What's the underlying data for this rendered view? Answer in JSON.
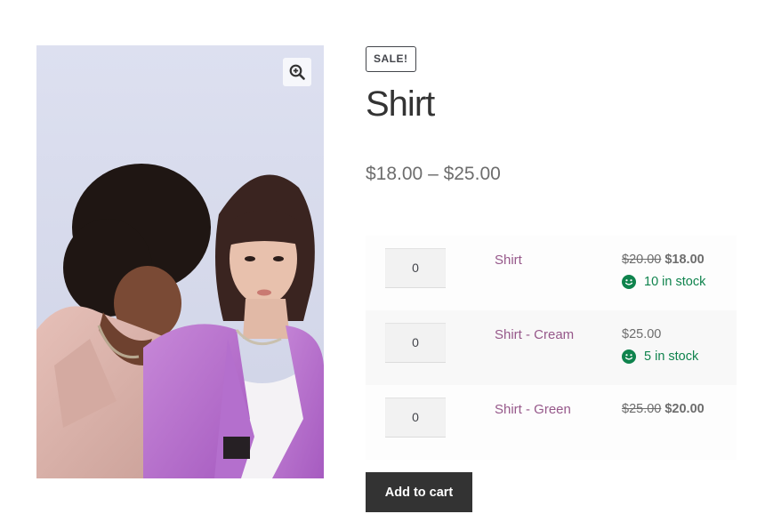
{
  "product": {
    "sale_badge": "SALE!",
    "title": "Shirt",
    "price_range": "$18.00 – $25.00"
  },
  "gallery": {
    "zoom_icon": "zoom-in-icon",
    "image_alt": "Two women in pink and purple shirts"
  },
  "grouped_items": [
    {
      "quantity": "0",
      "name": "Shirt",
      "old_price": "$20.00",
      "price": "$18.00",
      "stock": "10 in stock",
      "stock_icon": "smile-icon"
    },
    {
      "quantity": "0",
      "name": "Shirt - Cream",
      "old_price": "",
      "price": "$25.00",
      "stock": "5 in stock",
      "stock_icon": "smile-icon"
    },
    {
      "quantity": "0",
      "name": "Shirt - Green",
      "old_price": "$25.00",
      "price": "$20.00",
      "stock": "",
      "stock_icon": ""
    }
  ],
  "actions": {
    "add_to_cart_label": "Add to cart"
  },
  "colors": {
    "link": "#96588a",
    "in_stock": "#0f834d",
    "button_bg": "#333333",
    "text": "#43454b"
  }
}
